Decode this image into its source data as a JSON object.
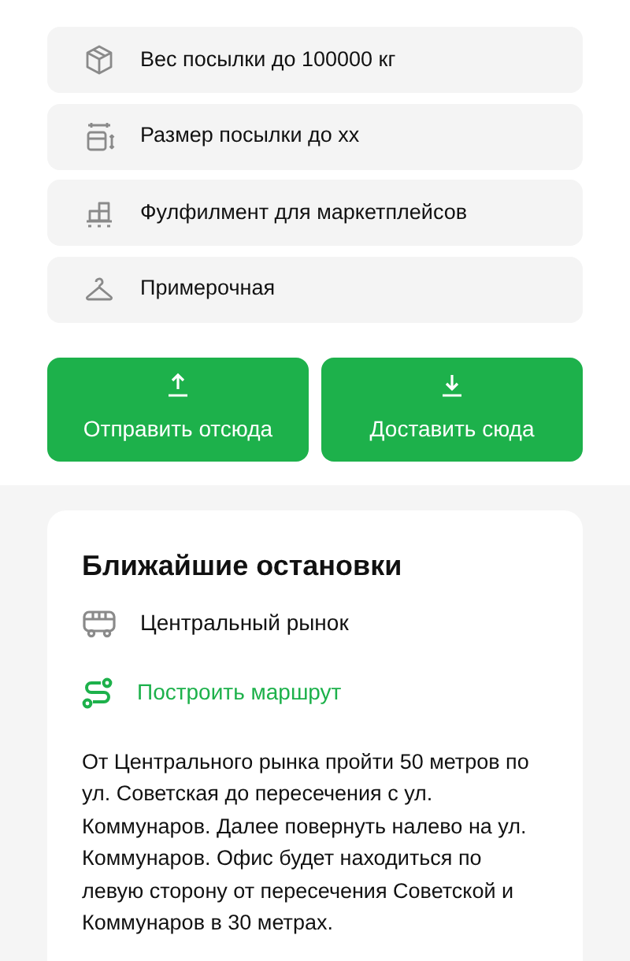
{
  "features": [
    {
      "kind": "box",
      "label": "Вес посылки до 100000 кг"
    },
    {
      "kind": "size",
      "label": "Размер посылки до хх"
    },
    {
      "kind": "pallet",
      "label": "Фулфилмент для маркетплейсов"
    },
    {
      "kind": "hanger",
      "label": "Примерочная"
    }
  ],
  "actions": [
    {
      "kind": "send",
      "label": "Отправить отсюда"
    },
    {
      "kind": "deliver",
      "label": "Доставить сюда"
    }
  ],
  "stops": {
    "title": "Ближайшие остановки",
    "stop": "Центральный рынок",
    "route_link": "Построить маршрут",
    "directions": "От Центрального рынка пройти 50 метров по ул. Советская до пересечения с ул. Коммунаров. Далее повернуть налево на ул. Коммунаров. Офис будет находиться по левую сторону от пересечения Советской и Коммунаров в 30 метрах."
  }
}
